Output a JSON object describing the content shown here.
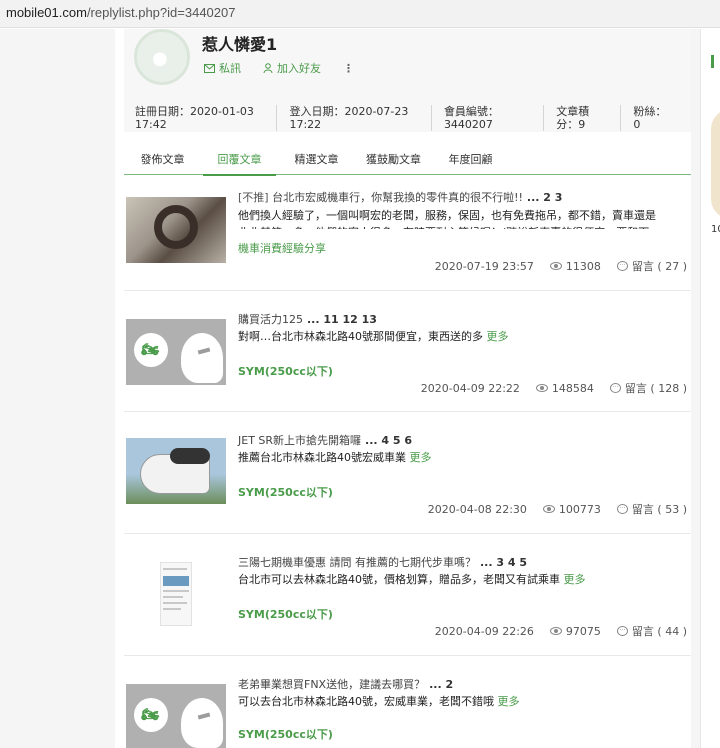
{
  "browser": {
    "url_host": "mobile01.com",
    "url_path": "/replylist.php?id=3440207"
  },
  "profile": {
    "username": "惹人憐愛1",
    "message_label": "私訊",
    "add_friend_label": "加入好友",
    "more_label": "⋮",
    "stats": [
      "註冊日期：2020-01-03 17:42",
      "登入日期：2020-07-23 17:22",
      "會員編號：3440207",
      "文章積分：9",
      "粉絲：0"
    ]
  },
  "tabs": [
    "發佈文章",
    "回覆文章",
    "精選文章",
    "獲鼓勵文章",
    "年度回顧"
  ],
  "active_tab": "回覆文章",
  "posts": [
    {
      "title_tag": "[不推]",
      "title": "台北市宏威機車行，你幫我換的零件真的很不行啦!!",
      "pages": "... 2 3",
      "snippet": "他們換人經驗了，一個叫啊宏的老闆，服務，保固，也有免費拖吊，都不錯，賣車還是北北基第一多，他們的客人很多，有時要耐心等候喔！(聽說新車賣的很便宜，要和下找老闆談",
      "more": "更多",
      "category": "機車消費經驗分享",
      "date": "2020-07-19 23:57",
      "views": "11308",
      "replies": "留言 ( 27 )"
    },
    {
      "title_tag": "",
      "title": "購買活力125",
      "pages": "... 11 12 13",
      "snippet": "對啊…台北市林森北路40號那間便宜，東西送的多",
      "more": "更多",
      "category": "SYM(250cc以下)",
      "date": "2020-04-09 22:22",
      "views": "148584",
      "replies": "留言 ( 128 )"
    },
    {
      "title_tag": "",
      "title": "JET SR新上市搶先開箱囉",
      "pages": "... 4 5 6",
      "snippet": "推薦台北市林森北路40號宏威車業",
      "more": "更多",
      "category": "SYM(250cc以下)",
      "date": "2020-04-08 22:30",
      "views": "100773",
      "replies": "留言 ( 53 )"
    },
    {
      "title_tag": "",
      "title": "三陽七期機車優惠 請問 有推薦的七期代步車嗎？",
      "pages": "... 3 4 5",
      "snippet": "台北市可以去林森北路40號，價格划算，贈品多，老闆又有試乘車",
      "more": "更多",
      "category": "SYM(250cc以下)",
      "date": "2020-04-09 22:26",
      "views": "97075",
      "replies": "留言 ( 44 )"
    },
    {
      "title_tag": "",
      "title": "老弟畢業想買FNX送他，建議去哪買？",
      "pages": "... 2",
      "snippet": "可以去台北市林森北路40號，宏威車業，老闆不錯哦",
      "more": "更多",
      "category": "SYM(250cc以下)",
      "date": "",
      "views": "",
      "replies": ""
    }
  ],
  "sidebar_right": {
    "teaser_count": "10"
  },
  "colors": {
    "accent": "#4a9b4a",
    "gutter": "#f5f5f5"
  }
}
